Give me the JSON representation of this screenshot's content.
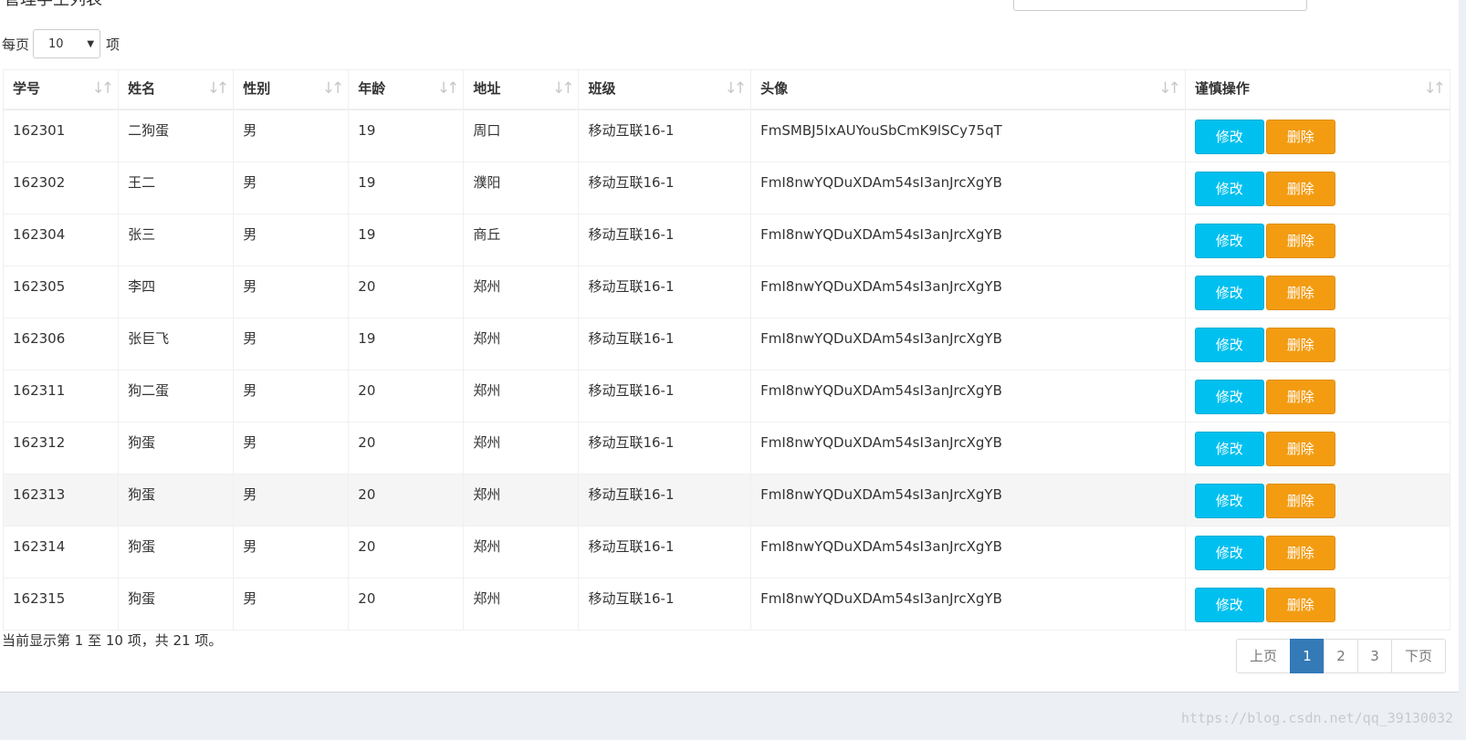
{
  "page_title": "管理学生列表",
  "length_menu": {
    "prefix": "每页",
    "value": "10",
    "suffix": "项"
  },
  "sort_glyph": "↓↑",
  "columns": [
    "学号",
    "姓名",
    "性别",
    "年龄",
    "地址",
    "班级",
    "头像",
    "谨慎操作"
  ],
  "rows": [
    {
      "id": "162301",
      "name": "二狗蛋",
      "gender": "男",
      "age": "19",
      "addr": "周口",
      "cls": "移动互联16-1",
      "avatar": "FmSMBJ5IxAUYouSbCmK9lSCy75qT"
    },
    {
      "id": "162302",
      "name": "王二",
      "gender": "男",
      "age": "19",
      "addr": "濮阳",
      "cls": "移动互联16-1",
      "avatar": "FmI8nwYQDuXDAm54sI3anJrcXgYB"
    },
    {
      "id": "162304",
      "name": "张三",
      "gender": "男",
      "age": "19",
      "addr": "商丘",
      "cls": "移动互联16-1",
      "avatar": "FmI8nwYQDuXDAm54sI3anJrcXgYB"
    },
    {
      "id": "162305",
      "name": "李四",
      "gender": "男",
      "age": "20",
      "addr": "郑州",
      "cls": "移动互联16-1",
      "avatar": "FmI8nwYQDuXDAm54sI3anJrcXgYB"
    },
    {
      "id": "162306",
      "name": "张巨飞",
      "gender": "男",
      "age": "19",
      "addr": "郑州",
      "cls": "移动互联16-1",
      "avatar": "FmI8nwYQDuXDAm54sI3anJrcXgYB"
    },
    {
      "id": "162311",
      "name": "狗二蛋",
      "gender": "男",
      "age": "20",
      "addr": "郑州",
      "cls": "移动互联16-1",
      "avatar": "FmI8nwYQDuXDAm54sI3anJrcXgYB"
    },
    {
      "id": "162312",
      "name": "狗蛋",
      "gender": "男",
      "age": "20",
      "addr": "郑州",
      "cls": "移动互联16-1",
      "avatar": "FmI8nwYQDuXDAm54sI3anJrcXgYB"
    },
    {
      "id": "162313",
      "name": "狗蛋",
      "gender": "男",
      "age": "20",
      "addr": "郑州",
      "cls": "移动互联16-1",
      "avatar": "FmI8nwYQDuXDAm54sI3anJrcXgYB"
    },
    {
      "id": "162314",
      "name": "狗蛋",
      "gender": "男",
      "age": "20",
      "addr": "郑州",
      "cls": "移动互联16-1",
      "avatar": "FmI8nwYQDuXDAm54sI3anJrcXgYB"
    },
    {
      "id": "162315",
      "name": "狗蛋",
      "gender": "男",
      "age": "20",
      "addr": "郑州",
      "cls": "移动互联16-1",
      "avatar": "FmI8nwYQDuXDAm54sI3anJrcXgYB"
    }
  ],
  "actions": {
    "edit": "修改",
    "delete": "删除"
  },
  "info_text": "当前显示第 1 至 10 项，共 21 项。",
  "pagination": {
    "prev": "上页",
    "pages": [
      "1",
      "2",
      "3"
    ],
    "active": "1",
    "next": "下页"
  },
  "watermark": "https://blog.csdn.net/qq_39130032",
  "colors": {
    "edit": "#00c0ef",
    "delete": "#f39c12",
    "active_page": "#337ab7"
  }
}
